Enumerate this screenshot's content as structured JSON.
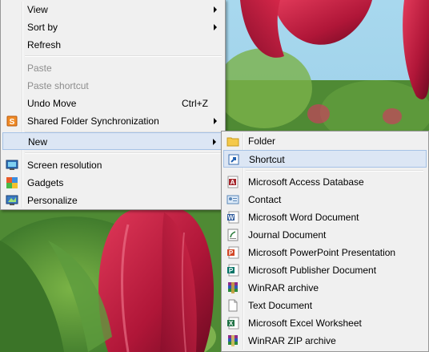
{
  "context_menu": {
    "items": [
      {
        "label": "View",
        "submenu": true,
        "icon": null
      },
      {
        "label": "Sort by",
        "submenu": true,
        "icon": null
      },
      {
        "label": "Refresh",
        "icon": null
      },
      {
        "label": "Paste",
        "disabled": true,
        "icon": null
      },
      {
        "label": "Paste shortcut",
        "disabled": true,
        "icon": null
      },
      {
        "label": "Undo Move",
        "shortcut": "Ctrl+Z",
        "icon": null
      },
      {
        "label": "Shared Folder Synchronization",
        "submenu": true,
        "icon": "shared-folder-sync-icon"
      },
      {
        "label": "New",
        "submenu": true,
        "highlighted": true,
        "icon": null
      },
      {
        "label": "Screen resolution",
        "icon": "screen-resolution-icon"
      },
      {
        "label": "Gadgets",
        "icon": "gadgets-icon"
      },
      {
        "label": "Personalize",
        "icon": "personalize-icon"
      }
    ]
  },
  "new_submenu": {
    "items": [
      {
        "label": "Folder",
        "icon": "folder-icon"
      },
      {
        "label": "Shortcut",
        "icon": "shortcut-icon",
        "highlighted": true
      },
      {
        "label": "Microsoft Access Database",
        "icon": "access-database-icon"
      },
      {
        "label": "Contact",
        "icon": "contact-icon"
      },
      {
        "label": "Microsoft Word Document",
        "icon": "word-document-icon"
      },
      {
        "label": "Journal Document",
        "icon": "journal-document-icon"
      },
      {
        "label": "Microsoft PowerPoint Presentation",
        "icon": "powerpoint-icon"
      },
      {
        "label": "Microsoft Publisher Document",
        "icon": "publisher-icon"
      },
      {
        "label": "WinRAR archive",
        "icon": "winrar-archive-icon"
      },
      {
        "label": "Text Document",
        "icon": "text-document-icon"
      },
      {
        "label": "Microsoft Excel Worksheet",
        "icon": "excel-icon"
      },
      {
        "label": "WinRAR ZIP archive",
        "icon": "winrar-zip-icon"
      }
    ]
  },
  "colors": {
    "menu_bg": "#f0f0f0",
    "highlight_bg": "#dce6f4",
    "highlight_border": "#a6c2e6",
    "disabled_text": "#8d8d8d"
  }
}
